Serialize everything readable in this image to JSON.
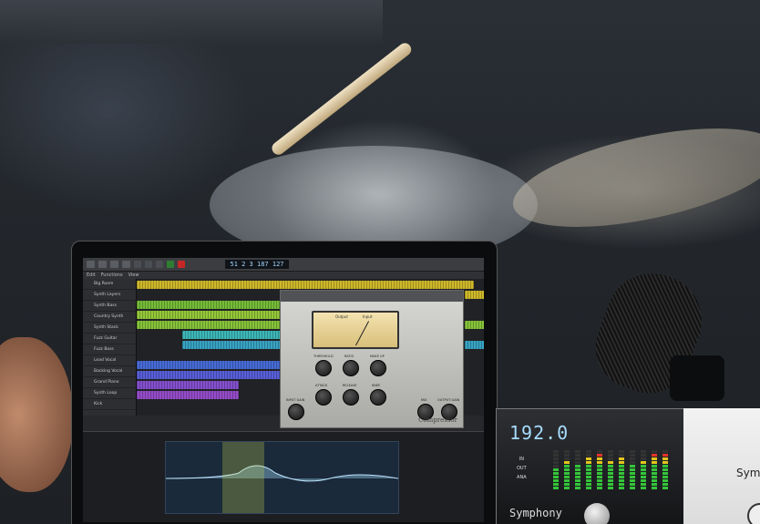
{
  "transport": {
    "position": "51 2 3 187",
    "tempo": "127"
  },
  "tracks": [
    "Big Room",
    "Synth Layers",
    "Synth Bass",
    "Country Synth",
    "Synth Stack",
    "Fuzz Guitar",
    "Fuzz Bass",
    "Lead Vocal",
    "Backing Vocal",
    "Grand Piano",
    "Synth Loop",
    "Kick"
  ],
  "plugin": {
    "name": "Compressor",
    "vu_mode_a": "Output",
    "vu_mode_b": "Input",
    "knobs": [
      "THRESHOLD",
      "RATIO",
      "MAKE UP",
      "ATTACK",
      "RELEASE",
      "KNEE",
      "INPUT GAIN",
      "MIX",
      "OUTPUT GAIN"
    ]
  },
  "interface": {
    "sample_rate": "192.0",
    "io_labels": [
      "IN",
      "OUT",
      "ANA"
    ],
    "brand": "Symphony",
    "brand2": "Symp",
    "meter_levels": [
      0.55,
      0.7,
      0.62,
      0.85,
      0.9,
      0.75,
      0.8,
      0.6,
      0.72,
      0.88,
      0.95
    ]
  },
  "colors": {
    "screen_bg": "#26282c",
    "freq_digits": "#a8dcff",
    "meter_green": "#35c43a",
    "meter_red": "#e3342a"
  }
}
